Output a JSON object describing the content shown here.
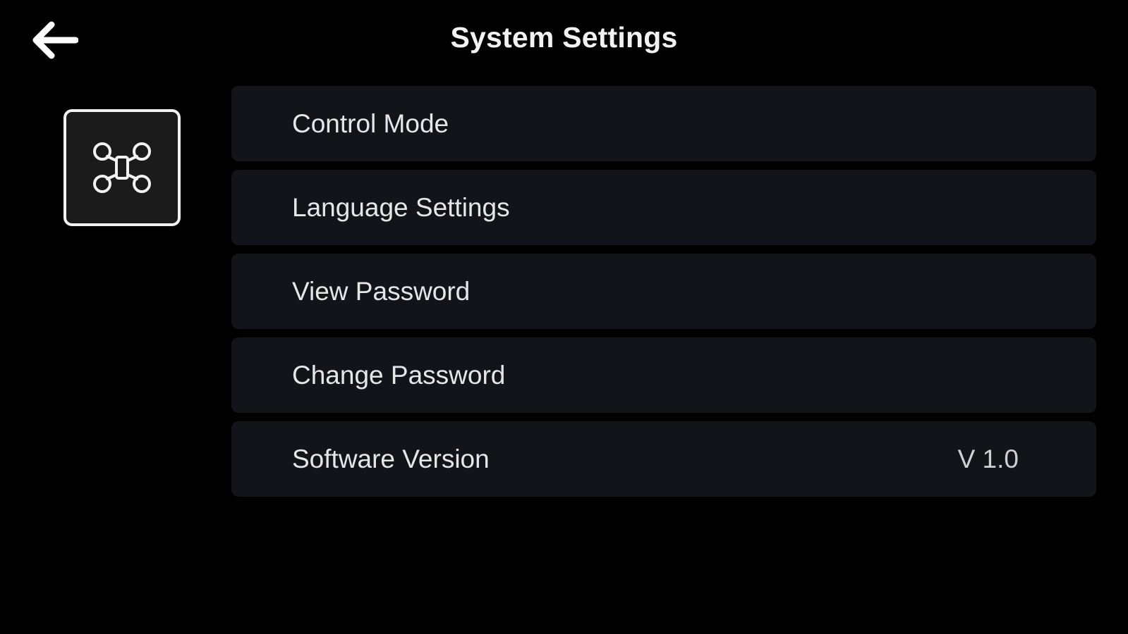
{
  "header": {
    "title": "System Settings",
    "back_icon": "arrow-left-icon"
  },
  "device": {
    "icon": "drone-icon"
  },
  "menu": {
    "items": [
      {
        "label": "Control Mode",
        "value": ""
      },
      {
        "label": "Language Settings",
        "value": ""
      },
      {
        "label": "View Password",
        "value": ""
      },
      {
        "label": "Change Password",
        "value": ""
      },
      {
        "label": "Software Version",
        "value": "V 1.0"
      }
    ]
  },
  "colors": {
    "background": "#000000",
    "row_background": "#12141a",
    "text": "#e6e6e6",
    "tile_border": "#f2f2f2"
  }
}
